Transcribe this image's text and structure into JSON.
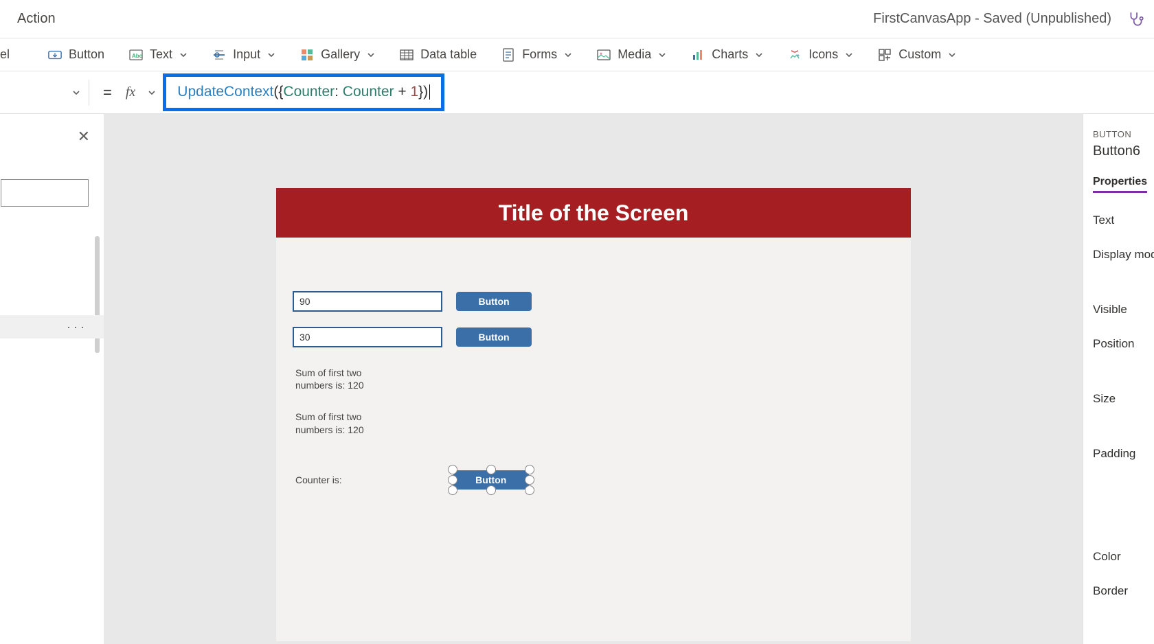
{
  "topbar": {
    "action_label": "Action",
    "app_title": "FirstCanvasApp - Saved (Unpublished)"
  },
  "ribbon": {
    "label_cut": "el",
    "button": "Button",
    "text": "Text",
    "input": "Input",
    "gallery": "Gallery",
    "data_table": "Data table",
    "forms": "Forms",
    "media": "Media",
    "charts": "Charts",
    "icons": "Icons",
    "custom": "Custom"
  },
  "formula": {
    "equals": "=",
    "fx": "fx",
    "func": "UpdateContext",
    "open": "({",
    "key": "Counter",
    "colon": ": ",
    "ref": "Counter",
    "plus": " + ",
    "num": "1",
    "close": "})"
  },
  "left": {
    "close": "✕",
    "dots": "···"
  },
  "canvas": {
    "title": "Title of the Screen",
    "input1": "90",
    "input2": "30",
    "btn": "Button",
    "sum1": "Sum of first two numbers is: 120",
    "sum2": "Sum of first two numbers is: 120",
    "counter_label": "Counter is:",
    "selected_btn": "Button"
  },
  "right": {
    "kind": "BUTTON",
    "name": "Button6",
    "tab": "Properties",
    "text": "Text",
    "display_mode": "Display mod",
    "visible": "Visible",
    "position": "Position",
    "size": "Size",
    "padding": "Padding",
    "color": "Color",
    "border": "Border"
  }
}
